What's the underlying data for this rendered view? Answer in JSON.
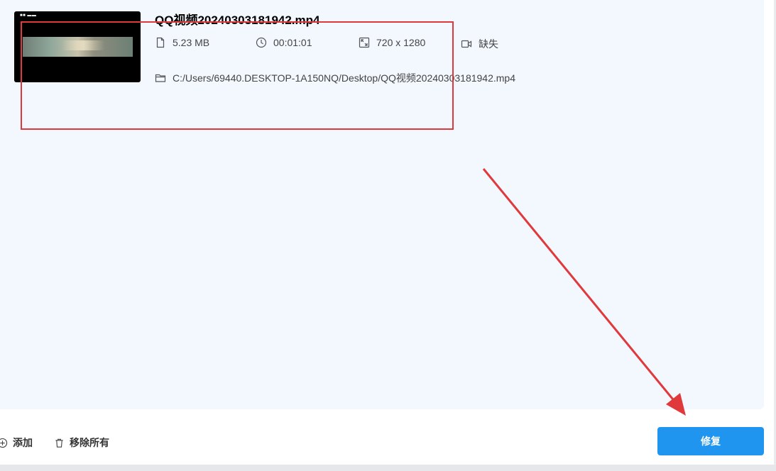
{
  "file": {
    "name": "QQ视频20240303181942.mp4",
    "size": "5.23  MB",
    "duration": "00:01:01",
    "resolution": "720 x 1280",
    "codec": "缺失",
    "path": "C:/Users/69440.DESKTOP-1A150NQ/Desktop/QQ视频20240303181942.mp4"
  },
  "toolbar": {
    "add_label": "添加",
    "remove_all_label": "移除所有",
    "repair_label": "修复"
  },
  "icons": {
    "size": "file-icon",
    "duration": "clock-icon",
    "resolution": "expand-icon",
    "codec": "video-camera-icon",
    "path": "folder-icon",
    "add": "plus-circle-icon",
    "remove": "trash-icon"
  },
  "colors": {
    "panel_bg": "#f3f7fe",
    "accent": "#1f95ef",
    "annotation_red": "#e0393c"
  }
}
